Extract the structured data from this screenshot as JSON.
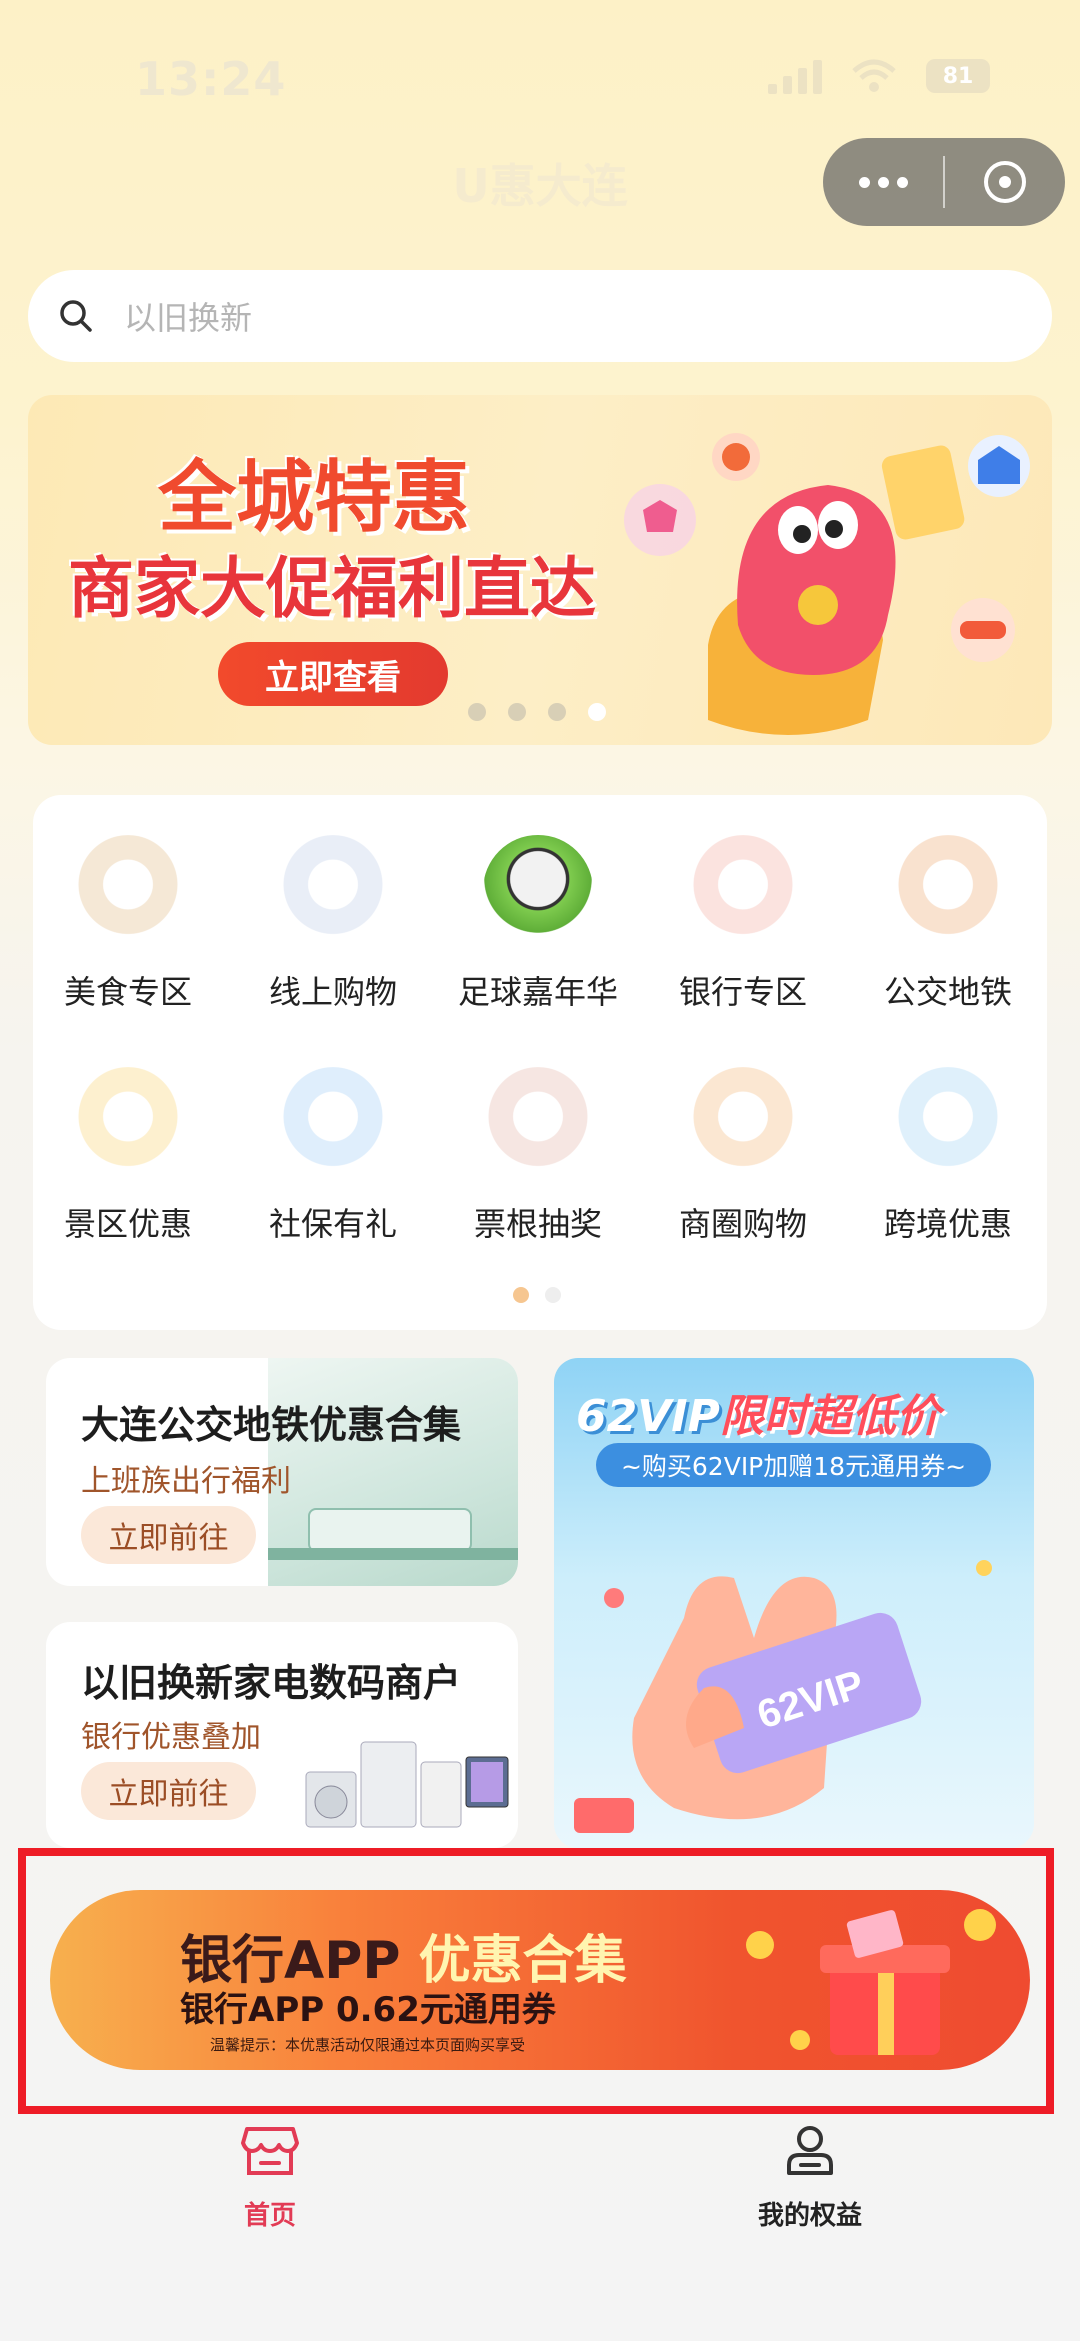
{
  "status_bar": {
    "time": "13:24",
    "battery": "81"
  },
  "app": {
    "title": "U惠大连"
  },
  "search": {
    "placeholder": "以旧换新"
  },
  "banner": {
    "line1": "全城特惠",
    "line2": "商家大促福利直达",
    "button": "立即查看"
  },
  "categories": [
    {
      "label": "美食专区"
    },
    {
      "label": "线上购物"
    },
    {
      "label": "足球嘉年华"
    },
    {
      "label": "银行专区"
    },
    {
      "label": "公交地铁"
    },
    {
      "label": "景区优惠"
    },
    {
      "label": "社保有礼"
    },
    {
      "label": "票根抽奖"
    },
    {
      "label": "商圈购物"
    },
    {
      "label": "跨境优惠"
    }
  ],
  "promos": {
    "transit": {
      "title": "大连公交地铁优惠合集",
      "subtitle": "上班族出行福利",
      "button": "立即前往"
    },
    "tradein": {
      "title": "以旧换新家电数码商户",
      "subtitle": "银行优惠叠加",
      "button": "立即前往"
    },
    "vip": {
      "title_a": "62VIP",
      "title_b": "限时超低价",
      "subtitle": "~购买62VIP加赠18元通用券~",
      "ticket": "62VIP"
    }
  },
  "bank_banner": {
    "title_a": "银行APP ",
    "title_b": "优惠合集",
    "subtitle": "银行APP 0.62元通用券",
    "note": "温馨提示：本优惠活动仅限通过本页面购买享受"
  },
  "tabbar": {
    "home": "首页",
    "benefits": "我的权益"
  },
  "colors": {
    "accent": "#e8353b",
    "tab_active": "#e23b55",
    "highlight": "#ee1c26"
  }
}
